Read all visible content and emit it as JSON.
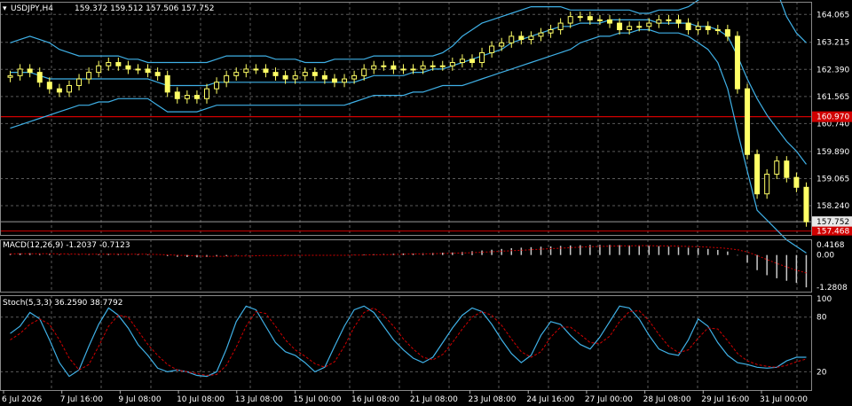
{
  "header": {
    "symbol": "USDJPY,H4",
    "ohlc": "159.372 159.512 157.506 157.752"
  },
  "macd_label": "MACD(12,26,9) -1.2037 -0.7123",
  "stoch_label": "Stoch(5,3,3) 36.2590 38.7792",
  "colors": {
    "background": "#000000",
    "grid": "#5a5a5a",
    "bull": "#ffff66",
    "bear": "#ffff66",
    "band": "#3fb0e6",
    "red_line": "#d10000",
    "macd_hist": "#c8c8c8",
    "macd_signal": "#d10000",
    "stoch_main": "#3fb0e6",
    "stoch_signal": "#d10000"
  },
  "chart_data": [
    {
      "type": "candlestick",
      "name": "price",
      "price_ticks": [
        "164.065",
        "163.215",
        "162.390",
        "161.565",
        "160.740",
        "159.890",
        "159.065",
        "158.240"
      ],
      "price_tick_values": [
        164.065,
        163.215,
        162.39,
        161.565,
        160.74,
        159.89,
        159.065,
        158.24
      ],
      "ylim": [
        157.35,
        164.45
      ],
      "current_price": "157.752",
      "current_value": 157.752,
      "red_line_value": 160.95,
      "red_line_label": "160.970",
      "bottom_red_label": "157.468",
      "bottom_red_value": 157.468,
      "x_labels": [
        "6 Jul 2026",
        "7 Jul 16:00",
        "9 Jul 08:00",
        "10 Jul 08:00",
        "13 Jul 08:00",
        "15 Jul 00:00",
        "16 Jul 08:00",
        "21 Jul 08:00",
        "23 Jul 08:00",
        "24 Jul 16:00",
        "27 Jul 00:00",
        "28 Jul 08:00",
        "29 Jul 16:00",
        "31 Jul 00:00"
      ],
      "closes": [
        162.2,
        162.4,
        162.3,
        162.0,
        161.8,
        161.7,
        161.9,
        162.1,
        162.3,
        162.5,
        162.6,
        162.5,
        162.4,
        162.4,
        162.3,
        162.2,
        161.7,
        161.5,
        161.6,
        161.5,
        161.8,
        162.0,
        162.2,
        162.3,
        162.4,
        162.4,
        162.3,
        162.2,
        162.1,
        162.2,
        162.3,
        162.2,
        162.1,
        162.0,
        162.1,
        162.2,
        162.4,
        162.5,
        162.5,
        162.4,
        162.4,
        162.4,
        162.5,
        162.5,
        162.5,
        162.6,
        162.7,
        162.6,
        162.9,
        163.1,
        163.2,
        163.4,
        163.3,
        163.4,
        163.5,
        163.6,
        163.8,
        164.0,
        164.0,
        163.9,
        163.9,
        163.8,
        163.6,
        163.7,
        163.7,
        163.8,
        163.9,
        163.9,
        163.8,
        163.6,
        163.7,
        163.6,
        163.6,
        163.4,
        161.8,
        159.8,
        158.6,
        159.2,
        159.6,
        159.1,
        158.8,
        157.75
      ],
      "bollinger_upper": [
        163.2,
        163.3,
        163.4,
        163.3,
        163.2,
        163.0,
        162.9,
        162.8,
        162.8,
        162.8,
        162.8,
        162.8,
        162.7,
        162.7,
        162.6,
        162.6,
        162.6,
        162.6,
        162.6,
        162.6,
        162.6,
        162.7,
        162.8,
        162.8,
        162.8,
        162.8,
        162.8,
        162.7,
        162.7,
        162.7,
        162.6,
        162.6,
        162.6,
        162.7,
        162.7,
        162.7,
        162.7,
        162.8,
        162.8,
        162.8,
        162.8,
        162.8,
        162.8,
        162.8,
        162.9,
        163.1,
        163.4,
        163.6,
        163.8,
        163.9,
        164.0,
        164.1,
        164.2,
        164.3,
        164.3,
        164.3,
        164.3,
        164.2,
        164.2,
        164.2,
        164.2,
        164.2,
        164.2,
        164.2,
        164.1,
        164.1,
        164.2,
        164.2,
        164.2,
        164.3,
        164.5,
        164.7,
        164.9,
        165.1,
        165.4,
        165.8,
        166.2,
        165.5,
        164.8,
        164.0,
        163.5,
        163.2
      ],
      "bollinger_middle": [
        162.3,
        162.3,
        162.3,
        162.2,
        162.1,
        162.1,
        162.1,
        162.1,
        162.1,
        162.1,
        162.1,
        162.1,
        162.1,
        162.1,
        162.1,
        162.0,
        161.9,
        161.9,
        161.9,
        161.9,
        161.9,
        162.0,
        162.0,
        162.0,
        162.0,
        162.0,
        162.0,
        162.0,
        162.0,
        162.0,
        162.0,
        162.0,
        162.0,
        162.0,
        162.0,
        162.0,
        162.1,
        162.2,
        162.2,
        162.2,
        162.2,
        162.3,
        162.3,
        162.4,
        162.4,
        162.5,
        162.6,
        162.7,
        162.8,
        162.9,
        163.0,
        163.2,
        163.3,
        163.4,
        163.5,
        163.6,
        163.7,
        163.7,
        163.8,
        163.8,
        163.8,
        163.9,
        163.9,
        163.9,
        163.9,
        163.9,
        163.8,
        163.8,
        163.8,
        163.8,
        163.7,
        163.7,
        163.6,
        163.4,
        162.8,
        162.1,
        161.5,
        161.0,
        160.6,
        160.2,
        159.9,
        159.5
      ],
      "bollinger_lower": [
        160.6,
        160.7,
        160.8,
        160.9,
        161.0,
        161.1,
        161.2,
        161.3,
        161.3,
        161.4,
        161.4,
        161.5,
        161.5,
        161.5,
        161.5,
        161.3,
        161.1,
        161.1,
        161.1,
        161.1,
        161.2,
        161.3,
        161.3,
        161.3,
        161.3,
        161.3,
        161.3,
        161.3,
        161.3,
        161.3,
        161.3,
        161.3,
        161.3,
        161.3,
        161.3,
        161.4,
        161.5,
        161.6,
        161.6,
        161.6,
        161.6,
        161.7,
        161.7,
        161.8,
        161.9,
        161.9,
        161.9,
        162.0,
        162.1,
        162.2,
        162.3,
        162.4,
        162.5,
        162.6,
        162.7,
        162.8,
        162.9,
        163.0,
        163.2,
        163.3,
        163.4,
        163.4,
        163.5,
        163.5,
        163.6,
        163.6,
        163.5,
        163.5,
        163.5,
        163.4,
        163.2,
        163.0,
        162.6,
        161.8,
        160.5,
        159.3,
        158.1,
        157.8,
        157.5,
        157.2,
        157.0,
        156.8
      ]
    },
    {
      "type": "histogram",
      "name": "macd",
      "ticks": [
        "0.4168",
        "0.00",
        "-1.2808"
      ],
      "tick_values": [
        0.4168,
        0.0,
        -1.2808
      ],
      "ylim": [
        -1.45,
        0.62
      ],
      "values": [
        0.05,
        0.06,
        0.07,
        0.06,
        0.04,
        0.02,
        0.01,
        0.01,
        0.02,
        0.03,
        0.04,
        0.04,
        0.04,
        0.03,
        0.02,
        0.0,
        -0.04,
        -0.07,
        -0.08,
        -0.09,
        -0.08,
        -0.06,
        -0.04,
        -0.02,
        -0.01,
        0.0,
        0.0,
        0.0,
        -0.01,
        0.0,
        0.0,
        0.0,
        0.0,
        -0.01,
        0.0,
        0.01,
        0.02,
        0.03,
        0.04,
        0.05,
        0.06,
        0.06,
        0.07,
        0.08,
        0.09,
        0.1,
        0.12,
        0.15,
        0.18,
        0.21,
        0.24,
        0.27,
        0.29,
        0.31,
        0.33,
        0.34,
        0.36,
        0.38,
        0.39,
        0.4,
        0.4,
        0.4,
        0.39,
        0.38,
        0.37,
        0.36,
        0.35,
        0.33,
        0.31,
        0.29,
        0.27,
        0.24,
        0.2,
        0.14,
        -0.02,
        -0.3,
        -0.6,
        -0.8,
        -0.92,
        -1.02,
        -1.1,
        -1.28
      ],
      "signal": [
        0.04,
        0.05,
        0.05,
        0.05,
        0.05,
        0.04,
        0.04,
        0.03,
        0.03,
        0.03,
        0.03,
        0.03,
        0.03,
        0.03,
        0.03,
        0.02,
        0.01,
        -0.01,
        -0.02,
        -0.04,
        -0.05,
        -0.05,
        -0.05,
        -0.04,
        -0.04,
        -0.03,
        -0.02,
        -0.02,
        -0.02,
        -0.01,
        -0.01,
        -0.01,
        -0.01,
        -0.01,
        -0.01,
        0.0,
        0.0,
        0.01,
        0.01,
        0.02,
        0.03,
        0.04,
        0.04,
        0.05,
        0.06,
        0.07,
        0.08,
        0.09,
        0.11,
        0.13,
        0.15,
        0.17,
        0.19,
        0.21,
        0.23,
        0.25,
        0.27,
        0.29,
        0.31,
        0.33,
        0.34,
        0.35,
        0.36,
        0.36,
        0.37,
        0.37,
        0.36,
        0.36,
        0.35,
        0.34,
        0.33,
        0.31,
        0.29,
        0.26,
        0.21,
        0.12,
        -0.02,
        -0.18,
        -0.33,
        -0.47,
        -0.6,
        -0.71
      ]
    },
    {
      "type": "line",
      "name": "stochastic",
      "ticks": [
        "100",
        "80",
        "20"
      ],
      "tick_values": [
        100,
        80,
        20
      ],
      "ylim": [
        0,
        104
      ],
      "main": [
        62,
        70,
        85,
        78,
        55,
        30,
        15,
        22,
        48,
        72,
        90,
        82,
        68,
        50,
        38,
        24,
        20,
        22,
        20,
        16,
        15,
        20,
        45,
        75,
        92,
        88,
        70,
        52,
        42,
        38,
        30,
        20,
        25,
        48,
        70,
        88,
        92,
        85,
        70,
        55,
        44,
        35,
        30,
        36,
        52,
        68,
        82,
        90,
        86,
        72,
        55,
        40,
        30,
        38,
        60,
        75,
        72,
        60,
        50,
        45,
        58,
        75,
        92,
        90,
        78,
        60,
        45,
        40,
        38,
        55,
        78,
        70,
        52,
        38,
        30,
        28,
        25,
        24,
        25,
        32,
        36,
        36
      ],
      "signal": [
        55,
        62,
        72,
        78,
        72,
        55,
        35,
        22,
        28,
        48,
        70,
        82,
        80,
        65,
        50,
        38,
        28,
        22,
        20,
        18,
        16,
        17,
        27,
        47,
        70,
        86,
        84,
        70,
        55,
        44,
        37,
        29,
        25,
        31,
        48,
        69,
        85,
        90,
        82,
        70,
        56,
        45,
        36,
        33,
        39,
        52,
        67,
        80,
        86,
        82,
        71,
        56,
        42,
        36,
        42,
        58,
        69,
        69,
        61,
        52,
        51,
        59,
        75,
        86,
        87,
        76,
        61,
        48,
        41,
        44,
        57,
        68,
        67,
        54,
        40,
        32,
        28,
        26,
        25,
        27,
        31,
        34
      ]
    }
  ]
}
